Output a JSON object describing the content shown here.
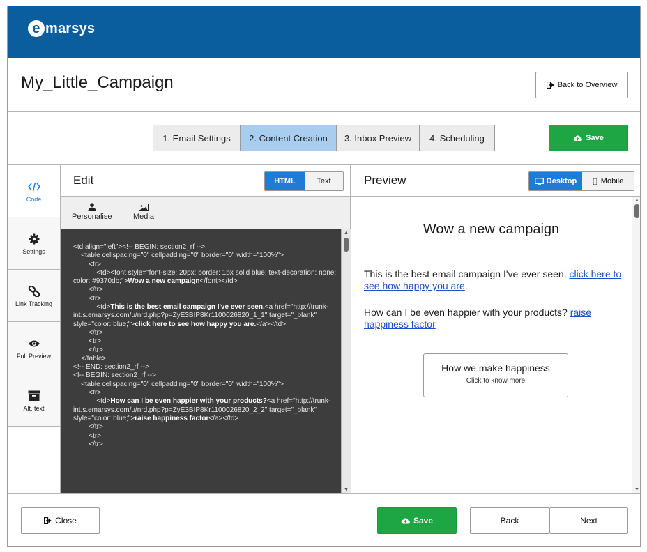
{
  "brand": {
    "logo_letter": "e",
    "logo_rest": "marsys",
    "color": "#0a5e9e"
  },
  "header": {
    "title": "My_Little_Campaign",
    "back_button": "Back to Overview"
  },
  "steps": [
    {
      "label": "1. Email Settings",
      "active": false
    },
    {
      "label": "2. Content Creation",
      "active": true
    },
    {
      "label": "3. Inbox Preview",
      "active": false
    },
    {
      "label": "4. Scheduling",
      "active": false
    }
  ],
  "save_label": "Save",
  "sidebar": [
    {
      "label": "Code",
      "icon": "code-icon"
    },
    {
      "label": "Settings",
      "icon": "gear-icon"
    },
    {
      "label": "Link Tracking",
      "icon": "link-icon"
    },
    {
      "label": "Full Preview",
      "icon": "eye-icon"
    },
    {
      "label": "Alt. text",
      "icon": "archive-icon"
    }
  ],
  "edit": {
    "title": "Edit",
    "toggle_html": "HTML",
    "toggle_text": "Text",
    "tool_personalise": "Personalise",
    "tool_media": "Media",
    "code_lines": [
      {
        "text": "<td align=\"left\"><!-- BEGIN: section2_rf -->"
      },
      {
        "text": "    <table cellspacing=\"0\" cellpadding=\"0\" border=\"0\" width=\"100%\">"
      },
      {
        "text": "        <tr>"
      },
      {
        "text": "            <td><font style=\"font-size: 20px; border: 1px solid blue; text-decoration: none; color: #9370db;\">",
        "bold": "Wow a new campaign",
        "after": "</font></td>"
      },
      {
        "text": "        </tr>"
      },
      {
        "text": "        <tr>"
      },
      {
        "text": "            <td>",
        "bold": "This is the best email campaign I've ever seen.",
        "after": "<a href=\"http://trunk-int.s.emarsys.com/u/nrd.php?p=ZyE3BIP8Kr1100026820_1_1\" target=\"_blank\" style=\"color: blue;\">",
        "bold2": "click here to see how happy you are.",
        "after2": "</a></td>"
      },
      {
        "text": "        </tr>"
      },
      {
        "text": "        <tr>"
      },
      {
        "text": "        </tr>"
      },
      {
        "text": "    </table>"
      },
      {
        "text": "<!-- END: section2_rf -->"
      },
      {
        "text": "<!-- BEGIN: section2_rf -->"
      },
      {
        "text": "    <table cellspacing=\"0\" cellpadding=\"0\" border=\"0\" width=\"100%\">"
      },
      {
        "text": "        <tr>"
      },
      {
        "text": "            <td>",
        "bold": "How can I be even happier with your products?",
        "after": "<a href=\"http://trunk-int.s.emarsys.com/u/nrd.php?p=ZyE3BIP8Kr1100026820_2_2\" target=\"_blank\" style=\"color: blue;\">",
        "bold2": "raise happiness factor",
        "after2": "</a></td>"
      },
      {
        "text": "        </tr>"
      },
      {
        "text": "        <tr>"
      },
      {
        "text": "        </tr>"
      }
    ]
  },
  "preview": {
    "title": "Preview",
    "toggle_desktop": "Desktop",
    "toggle_mobile": "Mobile",
    "heading": "Wow a new campaign",
    "p1_text": "This is the best email campaign I've ever seen. ",
    "p1_link": "click here to see how happy you are",
    "p1_end": ".",
    "p2_text": "How can I be even happier with your products? ",
    "p2_link": "raise happiness factor",
    "card_title": "How we make happiness",
    "card_sub": "Click to know more"
  },
  "footer": {
    "close": "Close",
    "save": "Save",
    "back": "Back",
    "next": "Next"
  },
  "colors": {
    "green": "#1fa644",
    "blue": "#1e7bd6",
    "active_step": "#a9cdee",
    "code_bg": "#3d3d3d"
  }
}
